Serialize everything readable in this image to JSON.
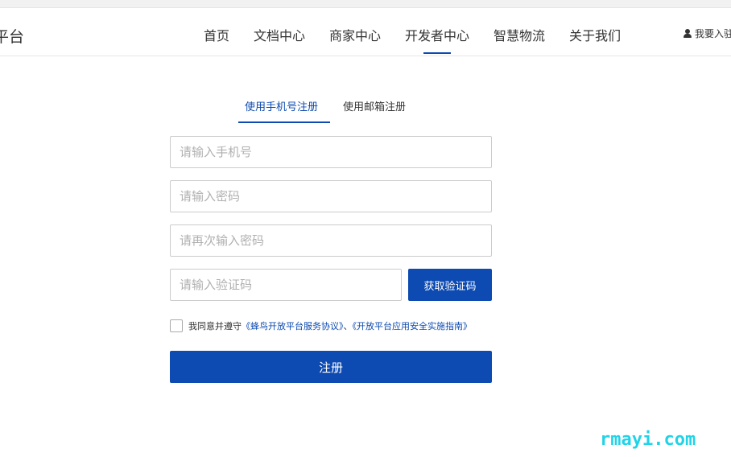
{
  "header": {
    "brand": "平台",
    "nav": [
      {
        "label": "首页"
      },
      {
        "label": "文档中心"
      },
      {
        "label": "商家中心"
      },
      {
        "label": "开发者中心",
        "active": true
      },
      {
        "label": "智慧物流"
      },
      {
        "label": "关于我们"
      }
    ],
    "join_label": "我要入驻"
  },
  "register": {
    "tabs": [
      {
        "label": "使用手机号注册",
        "active": true
      },
      {
        "label": "使用邮箱注册"
      }
    ],
    "phone": {
      "value": "",
      "placeholder": "请输入手机号"
    },
    "password": {
      "value": "",
      "placeholder": "请输入密码"
    },
    "password_confirm": {
      "value": "",
      "placeholder": "请再次输入密码"
    },
    "code": {
      "value": "",
      "placeholder": "请输入验证码"
    },
    "get_code_label": "获取验证码",
    "agree": {
      "checked": false,
      "prefix": "我同意并遵守",
      "link1": "《蜂鸟开放平台服务协议》",
      "separator": "、",
      "link2": "《开放平台应用安全实施指南》"
    },
    "submit_label": "注册"
  },
  "watermark": "rmayi.com",
  "colors": {
    "accent": "#0d4ab1",
    "watermark": "#22d3e8"
  }
}
